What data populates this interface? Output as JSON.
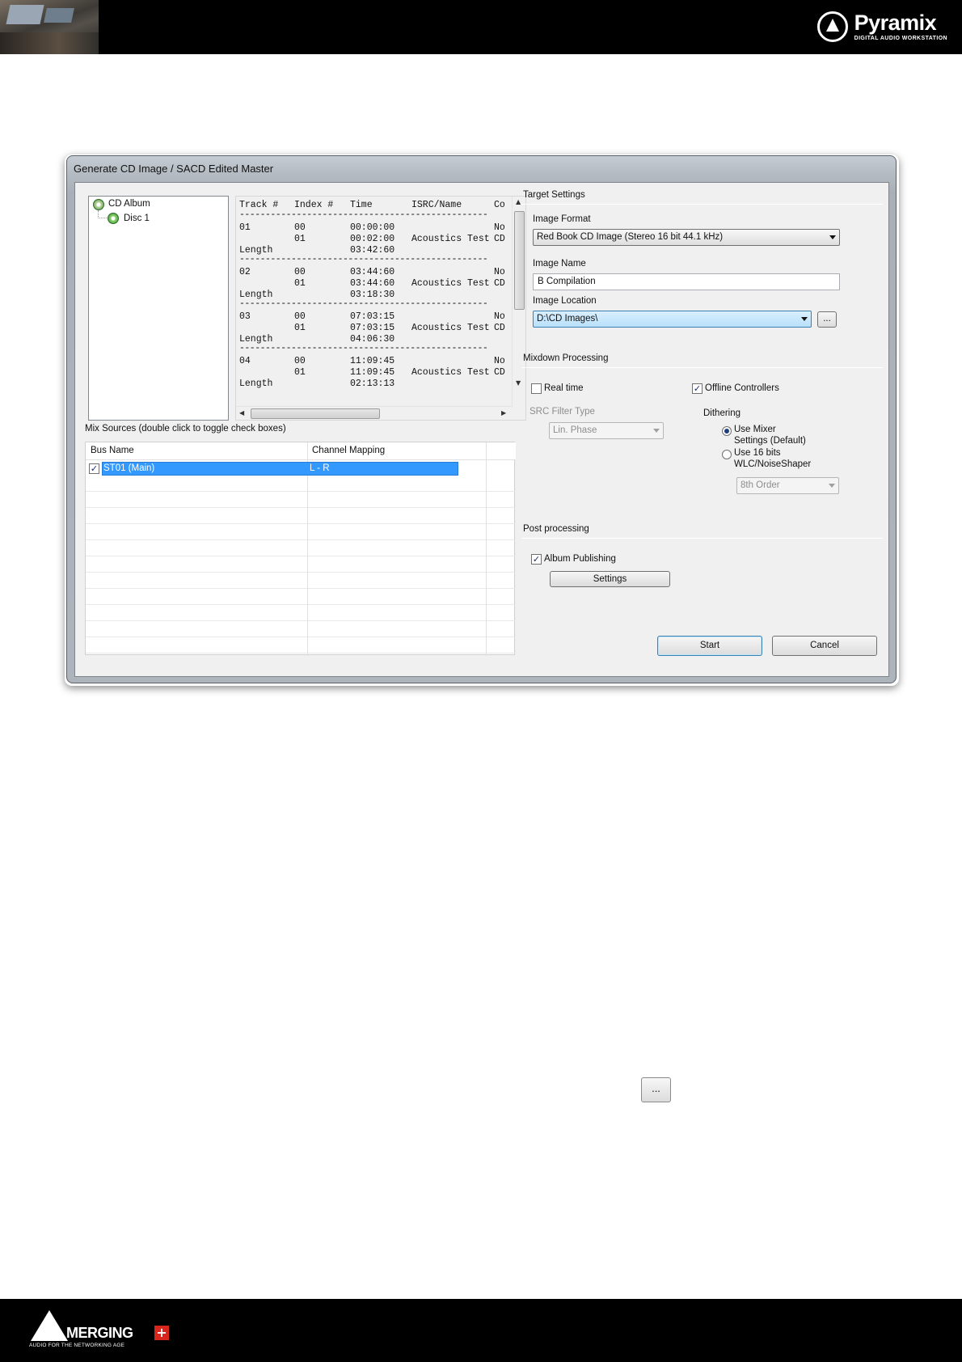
{
  "header": {
    "brand_name": "Pyramix",
    "brand_tagline": "DIGITAL AUDIO WORKSTATION"
  },
  "footer": {
    "brand_name": "MERGING",
    "brand_tagline": "AUDIO FOR THE NETWORKING AGE"
  },
  "dialog": {
    "title": "Generate CD Image / SACD Edited Master",
    "tree": {
      "root": "CD Album",
      "child": "Disc 1"
    },
    "tracklist": {
      "headers": [
        "Track #",
        "Index #",
        "Time",
        "ISRC/Name",
        "Co"
      ],
      "separator": "------------------------------------------------",
      "tracks": [
        {
          "track": "01",
          "rows": [
            {
              "index": "00",
              "time": "00:00:00",
              "name": "",
              "co": "No"
            },
            {
              "index": "01",
              "time": "00:02:00",
              "name": "Acoustics Test",
              "co": "CD"
            }
          ],
          "length_label": "Length",
          "length": "03:42:60"
        },
        {
          "track": "02",
          "rows": [
            {
              "index": "00",
              "time": "03:44:60",
              "name": "",
              "co": "No"
            },
            {
              "index": "01",
              "time": "03:44:60",
              "name": "Acoustics Test",
              "co": "CD"
            }
          ],
          "length_label": "Length",
          "length": "03:18:30"
        },
        {
          "track": "03",
          "rows": [
            {
              "index": "00",
              "time": "07:03:15",
              "name": "",
              "co": "No"
            },
            {
              "index": "01",
              "time": "07:03:15",
              "name": "Acoustics Test",
              "co": "CD"
            }
          ],
          "length_label": "Length",
          "length": "04:06:30"
        },
        {
          "track": "04",
          "rows": [
            {
              "index": "00",
              "time": "11:09:45",
              "name": "",
              "co": "No"
            },
            {
              "index": "01",
              "time": "11:09:45",
              "name": "Acoustics Test",
              "co": "CD"
            }
          ],
          "length_label": "Length",
          "length": "02:13:13"
        }
      ]
    },
    "mix_sources": {
      "label": "Mix Sources (double click to toggle check boxes)",
      "columns": [
        "Bus Name",
        "Channel Mapping"
      ],
      "rows": [
        {
          "checked": true,
          "bus": "ST01 (Main)",
          "mapping": "L - R"
        }
      ]
    },
    "target": {
      "group_label": "Target Settings",
      "format_label": "Image Format",
      "format_value": "Red Book CD Image (Stereo 16 bit 44.1 kHz)",
      "name_label": "Image Name",
      "name_value": "B Compilation",
      "location_label": "Image Location",
      "location_value": "D:\\CD Images\\",
      "browse_label": "..."
    },
    "mixdown": {
      "group_label": "Mixdown Processing",
      "realtime_label": "Real time",
      "realtime_checked": false,
      "offline_label": "Offline Controllers",
      "offline_checked": true,
      "src_label": "SRC Filter Type",
      "src_value": "Lin. Phase",
      "dithering_label": "Dithering",
      "dither_opt1_line1": "Use Mixer",
      "dither_opt1_line2": "Settings (Default)",
      "dither_opt2_line1": "Use 16 bits",
      "dither_opt2_line2": "WLC/NoiseShaper",
      "dither_selected": "Use Mixer Settings (Default)",
      "order_value": "8th Order"
    },
    "post": {
      "group_label": "Post processing",
      "album_label": "Album Publishing",
      "album_checked": true,
      "settings_label": "Settings"
    },
    "buttons": {
      "start": "Start",
      "cancel": "Cancel"
    }
  },
  "inline_button": {
    "label": "..."
  }
}
